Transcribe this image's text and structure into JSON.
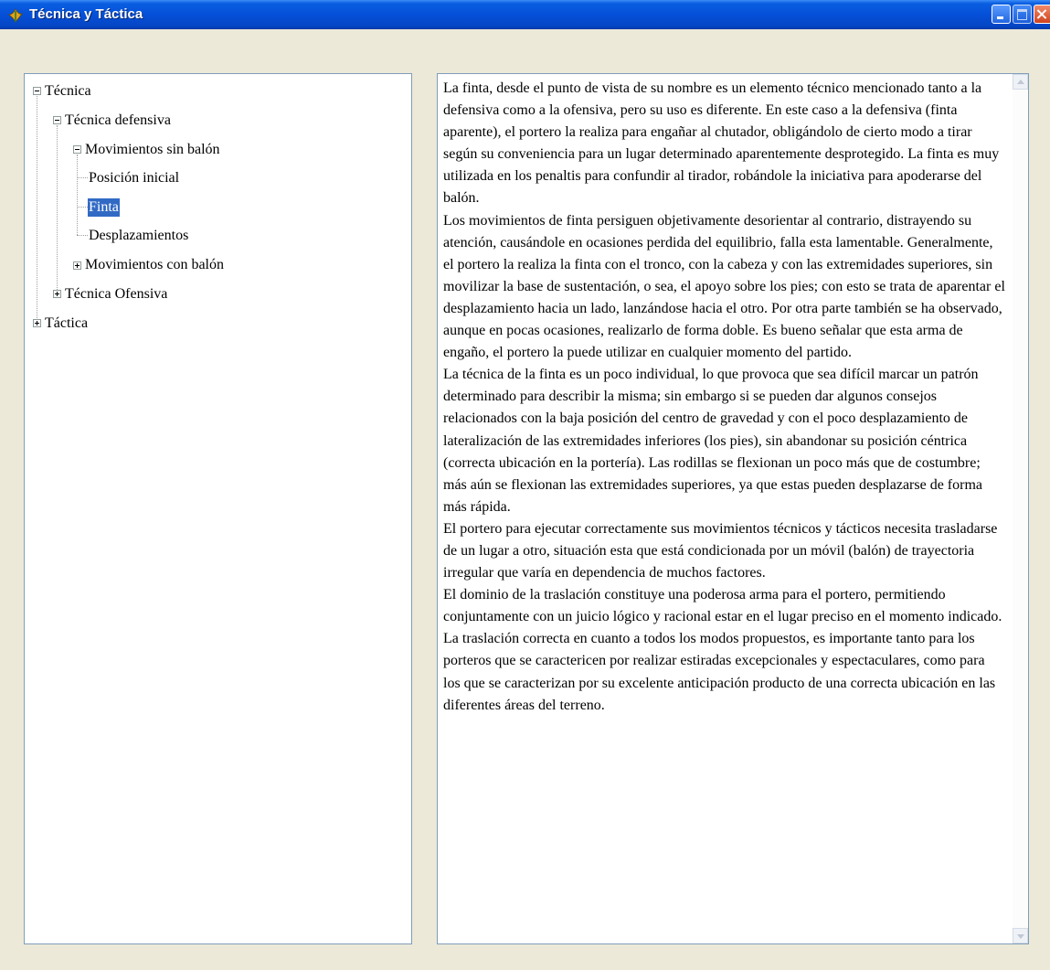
{
  "window": {
    "title": "Técnica y Táctica"
  },
  "tree": {
    "tecnica": "Técnica",
    "tecnica_defensiva": "Técnica defensiva",
    "movimientos_sin_balon": "Movimientos sin balón",
    "posicion_inicial": "Posición inicial",
    "finta": "Finta",
    "desplazamientos": "Desplazamientos",
    "movimientos_con_balon": "Movimientos con balón",
    "tecnica_ofensiva": "Técnica Ofensiva",
    "tactica": "Táctica",
    "selected": "Finta"
  },
  "content": {
    "paragraphs": [
      "La finta, desde el punto de vista de su nombre es un elemento técnico mencionado tanto a la defensiva como a la ofensiva, pero su uso es diferente. En este caso a la defensiva (finta aparente), el portero la realiza para engañar al chutador, obligándolo de cierto modo a tirar según su conveniencia para un lugar determinado aparentemente desprotegido. La finta es muy utilizada en los penaltis para confundir al tirador, robándole la iniciativa para apoderarse del balón.",
      "Los movimientos de finta persiguen objetivamente desorientar al contrario, distrayendo su atención, causándole en ocasiones perdida del equilibrio, falla esta lamentable. Generalmente, el portero la realiza la finta con el tronco, con la cabeza y con las extremidades superiores, sin movilizar la base de sustentación, o sea, el apoyo sobre los pies; con esto se trata de aparentar el desplazamiento hacia un lado, lanzándose hacia el otro. Por otra parte también se ha observado, aunque en pocas ocasiones, realizarlo de forma doble. Es bueno señalar que esta arma de engaño,  el portero la puede utilizar en cualquier momento del partido.",
      "La técnica de la finta es un poco individual, lo que provoca que sea  difícil marcar un patrón determinado para describir la misma; sin embargo si  se pueden dar algunos consejos relacionados con la baja posición del centro de gravedad y con el poco desplazamiento de lateralización de las extremidades inferiores (los pies), sin abandonar su posición céntrica (correcta ubicación en la portería). Las rodillas se flexionan un poco más que de costumbre; más aún se flexionan las extremidades superiores, ya que estas pueden desplazarse de forma más rápida.",
      "El portero para ejecutar correctamente sus movimientos técnicos y tácticos necesita trasladarse de un lugar a otro, situación esta que está  condicionada por un móvil  (balón) de trayectoria irregular que varía en dependencia de muchos factores.",
      "El dominio de la traslación constituye una poderosa arma para el portero, permitiendo conjuntamente con un juicio lógico y  racional estar en el lugar preciso en el momento indicado.",
      "La traslación correcta en cuanto a todos los modos propuestos,  es importante tanto para los porteros que se caractericen por realizar estiradas excepcionales y espectaculares, como para los que se caracterizan por su excelente anticipación producto de una correcta ubicación en las  diferentes áreas del terreno."
    ]
  },
  "icons": {
    "app": "app-icon",
    "minimize": "minimize-icon",
    "maximize": "maximize-icon",
    "close": "close-icon"
  },
  "colors": {
    "titlebar": "#0550d8",
    "selection": "#316ac5",
    "background": "#ece9d8"
  }
}
